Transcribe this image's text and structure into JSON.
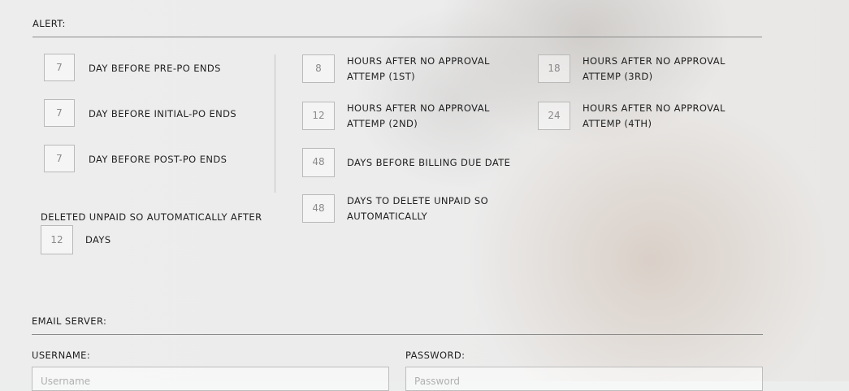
{
  "alert": {
    "title": "ALERT:",
    "po_rows": [
      {
        "value": "7",
        "label": "DAY BEFORE PRE-PO ENDS"
      },
      {
        "value": "7",
        "label": "DAY BEFORE INITIAL-PO ENDS"
      },
      {
        "value": "7",
        "label": "DAY BEFORE POST-PO ENDS"
      }
    ],
    "deleted_unpaid": {
      "label": "DELETED UNPAID SO AUTOMATICALLY AFTER",
      "value": "12",
      "unit": "DAYS"
    },
    "approval": [
      {
        "value": "8",
        "line1": "HOURS AFTER NO APPROVAL",
        "line2": "ATTEMP (1ST)"
      },
      {
        "value": "12",
        "line1": "HOURS AFTER NO APPROVAL",
        "line2": "ATTEMP (2ND)"
      },
      {
        "value": "18",
        "line1": "HOURS AFTER NO APPROVAL",
        "line2": "ATTEMP (3RD)"
      },
      {
        "value": "24",
        "line1": "HOURS AFTER NO APPROVAL",
        "line2": "ATTEMP (4TH)"
      }
    ],
    "billing": {
      "value": "48",
      "label": "DAYS BEFORE BILLING DUE DATE"
    },
    "delete_unpaid": {
      "value": "48",
      "line1": "DAYS TO DELETE UNPAID SO",
      "line2": "AUTOMATICALLY"
    }
  },
  "email": {
    "title": "EMAIL SERVER:",
    "username_label": "USERNAME:",
    "username_placeholder": "Username",
    "password_label": "PASSWORD:",
    "password_placeholder": "Password"
  }
}
